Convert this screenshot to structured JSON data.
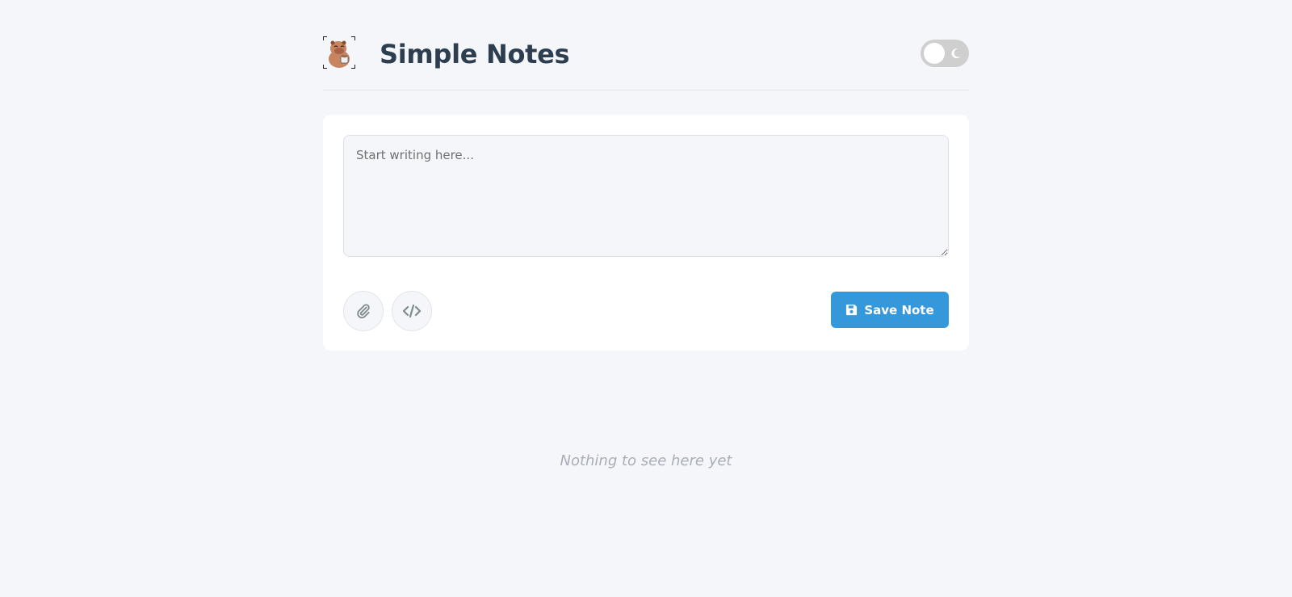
{
  "header": {
    "title": "Simple Notes",
    "logo_icon": "capybara-logo-icon",
    "theme_toggle": {
      "state": "off",
      "icon": "moon-icon"
    }
  },
  "editor": {
    "placeholder": "Start writing here...",
    "value": ""
  },
  "toolbar": {
    "attach_icon": "paperclip-icon",
    "code_icon": "code-icon",
    "save_label": "Save Note",
    "save_icon": "floppy-disk-icon"
  },
  "notes": {
    "empty_message": "Nothing to see here yet"
  },
  "colors": {
    "background": "#f5f6fa",
    "accent": "#3498db",
    "title": "#2c3e50",
    "toggle_track": "#cfcfcf",
    "muted_text": "#a9adb5"
  }
}
